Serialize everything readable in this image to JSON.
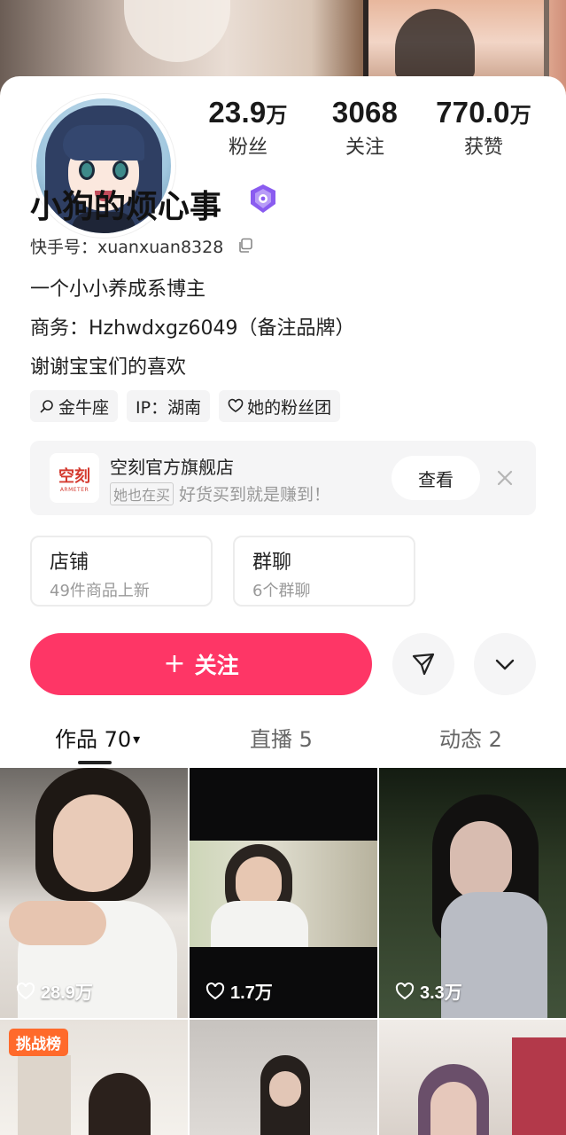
{
  "profile": {
    "name": "小狗的烦心事",
    "uid": "快手号：xuanxuan8328",
    "bio": [
      "一个小小养成系博主",
      "商务：Hzhwdxgz6049（备注品牌）",
      "谢谢宝宝们的喜欢"
    ]
  },
  "stats": [
    {
      "value": "23.9",
      "unit": "万",
      "label": "粉丝"
    },
    {
      "value": "3068",
      "unit": "",
      "label": "关注"
    },
    {
      "value": "770.0",
      "unit": "万",
      "label": "获赞"
    }
  ],
  "tags": [
    "金牛座",
    "IP：湖南",
    "她的粉丝团"
  ],
  "shop_banner": {
    "logo_text": "空刻",
    "logo_subtext": "ARMETER",
    "title": "空刻官方旗舰店",
    "chip": "她也在买",
    "subtitle": "好货买到就是赚到！",
    "view_label": "查看"
  },
  "cards": [
    {
      "title": "店铺",
      "subtitle": "49件商品上新"
    },
    {
      "title": "群聊",
      "subtitle": "6个群聊"
    }
  ],
  "actions": {
    "plus": "+",
    "follow_label": "关注"
  },
  "tabs": [
    {
      "label": "作品 70",
      "active": true
    },
    {
      "label": "直播 5",
      "active": false
    },
    {
      "label": "动态 2",
      "active": false
    }
  ],
  "tab_caret": "▾",
  "videos": [
    {
      "likes": "28.9万"
    },
    {
      "likes": "1.7万"
    },
    {
      "likes": "3.3万"
    }
  ],
  "rank_badge": "挑战榜",
  "colors": {
    "accent": "#fe3666",
    "rank": "#ff6a2b",
    "verify": "#8a5cf0"
  }
}
